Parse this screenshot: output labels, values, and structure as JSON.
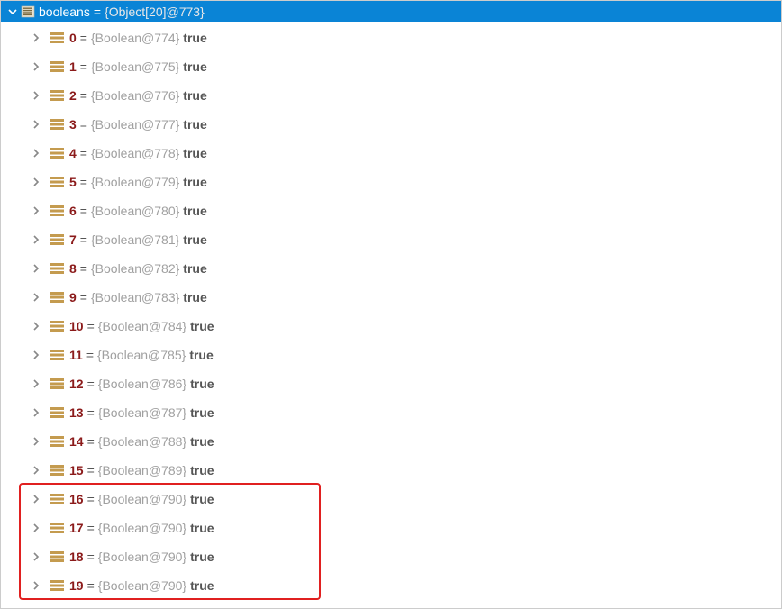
{
  "header": {
    "name": "booleans",
    "eq": "=",
    "value": "{Object[20]@773}"
  },
  "entry_eq": " = ",
  "entries": [
    {
      "index": "0",
      "ref": "{Boolean@774}",
      "val": "true",
      "hi": false
    },
    {
      "index": "1",
      "ref": "{Boolean@775}",
      "val": "true",
      "hi": false
    },
    {
      "index": "2",
      "ref": "{Boolean@776}",
      "val": "true",
      "hi": false
    },
    {
      "index": "3",
      "ref": "{Boolean@777}",
      "val": "true",
      "hi": false
    },
    {
      "index": "4",
      "ref": "{Boolean@778}",
      "val": "true",
      "hi": false
    },
    {
      "index": "5",
      "ref": "{Boolean@779}",
      "val": "true",
      "hi": false
    },
    {
      "index": "6",
      "ref": "{Boolean@780}",
      "val": "true",
      "hi": false
    },
    {
      "index": "7",
      "ref": "{Boolean@781}",
      "val": "true",
      "hi": false
    },
    {
      "index": "8",
      "ref": "{Boolean@782}",
      "val": "true",
      "hi": false
    },
    {
      "index": "9",
      "ref": "{Boolean@783}",
      "val": "true",
      "hi": false
    },
    {
      "index": "10",
      "ref": "{Boolean@784}",
      "val": "true",
      "hi": false
    },
    {
      "index": "11",
      "ref": "{Boolean@785}",
      "val": "true",
      "hi": false
    },
    {
      "index": "12",
      "ref": "{Boolean@786}",
      "val": "true",
      "hi": false
    },
    {
      "index": "13",
      "ref": "{Boolean@787}",
      "val": "true",
      "hi": false
    },
    {
      "index": "14",
      "ref": "{Boolean@788}",
      "val": "true",
      "hi": false
    },
    {
      "index": "15",
      "ref": "{Boolean@789}",
      "val": "true",
      "hi": false
    },
    {
      "index": "16",
      "ref": "{Boolean@790}",
      "val": "true",
      "hi": true
    },
    {
      "index": "17",
      "ref": "{Boolean@790}",
      "val": "true",
      "hi": true
    },
    {
      "index": "18",
      "ref": "{Boolean@790}",
      "val": "true",
      "hi": true
    },
    {
      "index": "19",
      "ref": "{Boolean@790}",
      "val": "true",
      "hi": true
    }
  ]
}
